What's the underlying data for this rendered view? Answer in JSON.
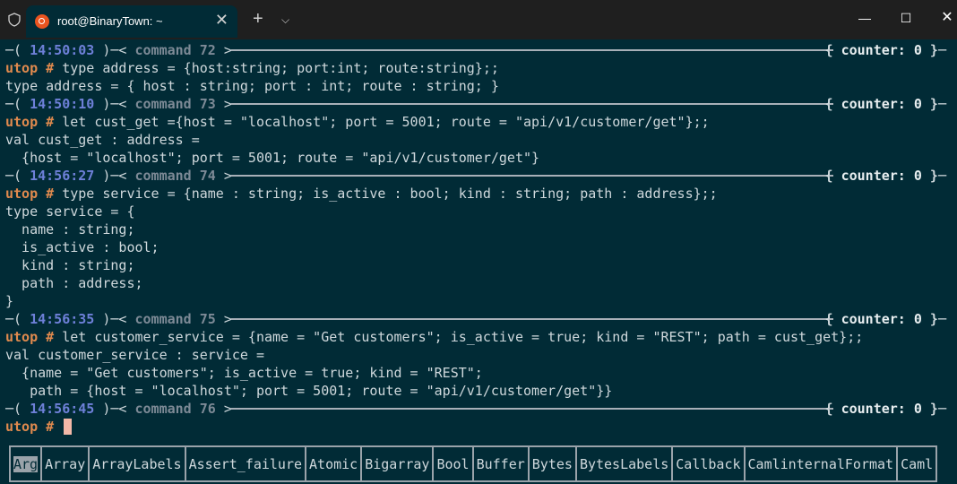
{
  "titlebar": {
    "tab_title": "root@BinaryTown: ~",
    "tab_close": "✕",
    "new_tab": "+",
    "tab_dropdown": "⌵",
    "win_min": "—",
    "win_max": "☐",
    "win_close": "✕"
  },
  "colors": {
    "background": "#012b36",
    "prompt": "#e08a4e",
    "time": "#6e80d8",
    "cursor": "#f2b8a8"
  },
  "prompt": "utop # ",
  "counter_label": "counter: 0",
  "headers": [
    {
      "time": "14:50:03",
      "command": "command 72"
    },
    {
      "time": "14:50:10",
      "command": "command 73"
    },
    {
      "time": "14:56:27",
      "command": "command 74"
    },
    {
      "time": "14:56:35",
      "command": "command 75"
    },
    {
      "time": "14:56:45",
      "command": "command 76"
    }
  ],
  "blocks": [
    {
      "input": "type address = {host:string; port:int; route:string};;",
      "output": [
        "type address = { host : string; port : int; route : string; }"
      ]
    },
    {
      "input": "let cust_get ={host = \"localhost\"; port = 5001; route = \"api/v1/customer/get\"};;",
      "output": [
        "val cust_get : address =",
        "  {host = \"localhost\"; port = 5001; route = \"api/v1/customer/get\"}"
      ]
    },
    {
      "input": "type service = {name : string; is_active : bool; kind : string; path : address};;",
      "output": [
        "type service = {",
        "  name : string;",
        "  is_active : bool;",
        "  kind : string;",
        "  path : address;",
        "}"
      ]
    },
    {
      "input": "let customer_service = {name = \"Get customers\"; is_active = true; kind = \"REST\"; path = cust_get};;",
      "output": [
        "val customer_service : service =",
        "  {name = \"Get customers\"; is_active = true; kind = \"REST\";",
        "   path = {host = \"localhost\"; port = 5001; route = \"api/v1/customer/get\"}}"
      ]
    }
  ],
  "completions": [
    "Arg",
    "Array",
    "ArrayLabels",
    "Assert_failure",
    "Atomic",
    "Bigarray",
    "Bool",
    "Buffer",
    "Bytes",
    "BytesLabels",
    "Callback",
    "CamlinternalFormat",
    "Caml"
  ]
}
